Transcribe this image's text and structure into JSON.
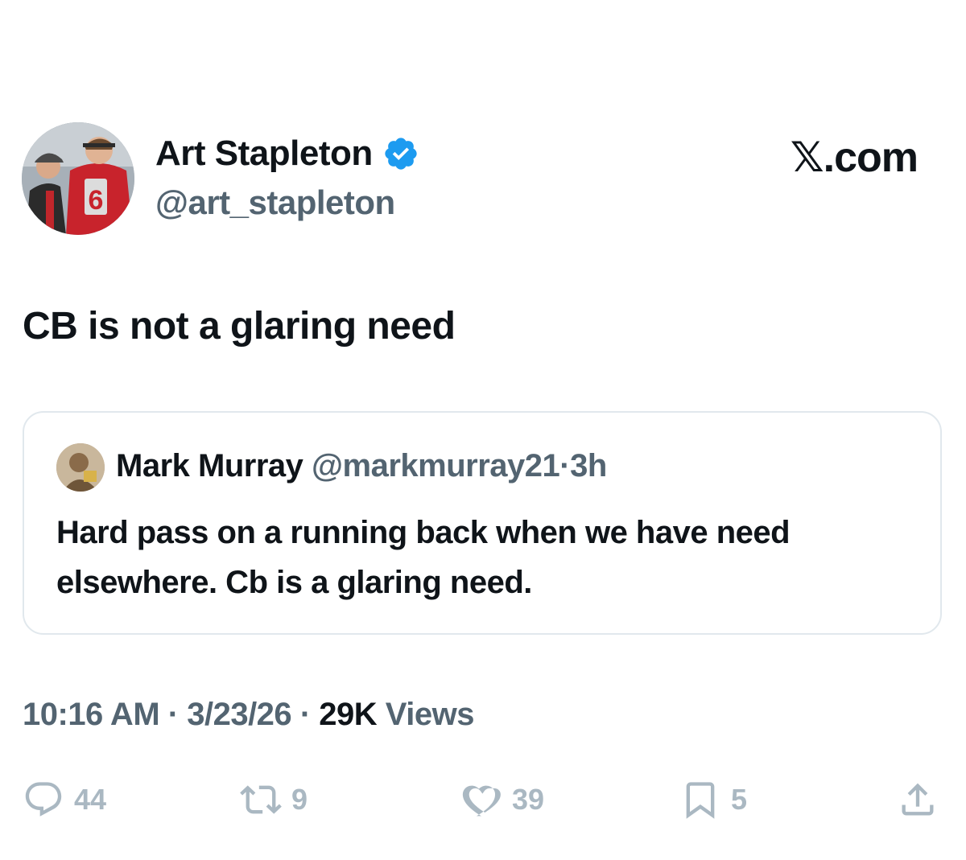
{
  "author": {
    "name": "Art Stapleton",
    "handle": "@art_stapleton",
    "verified": true,
    "jersey_number": "6"
  },
  "brand": "𝕏.com",
  "tweet": {
    "text": "CB is not a glaring need"
  },
  "quote": {
    "name": "Mark Murray",
    "handle": "@markmurray21",
    "separator": "·",
    "time": "3h",
    "text": "Hard pass on a running back when we have need elsewhere.  Cb is a glaring need."
  },
  "meta": {
    "time": "10:16 AM",
    "date": "3/23/26",
    "separator": "·",
    "views_count": "29K",
    "views_label": " Views"
  },
  "actions": {
    "replies": "44",
    "reposts": "9",
    "likes": "39",
    "bookmarks": "5"
  },
  "icons": {
    "verified": "verified-badge-icon",
    "reply": "reply-icon",
    "repost": "repost-icon",
    "like": "heart-icon",
    "bookmark": "bookmark-icon",
    "share": "share-icon"
  },
  "colors": {
    "verified": "#1d9bf0",
    "text": "#0f1419",
    "secondary": "#536471",
    "actions": "#aab8c2",
    "border": "#e1e8ed"
  }
}
